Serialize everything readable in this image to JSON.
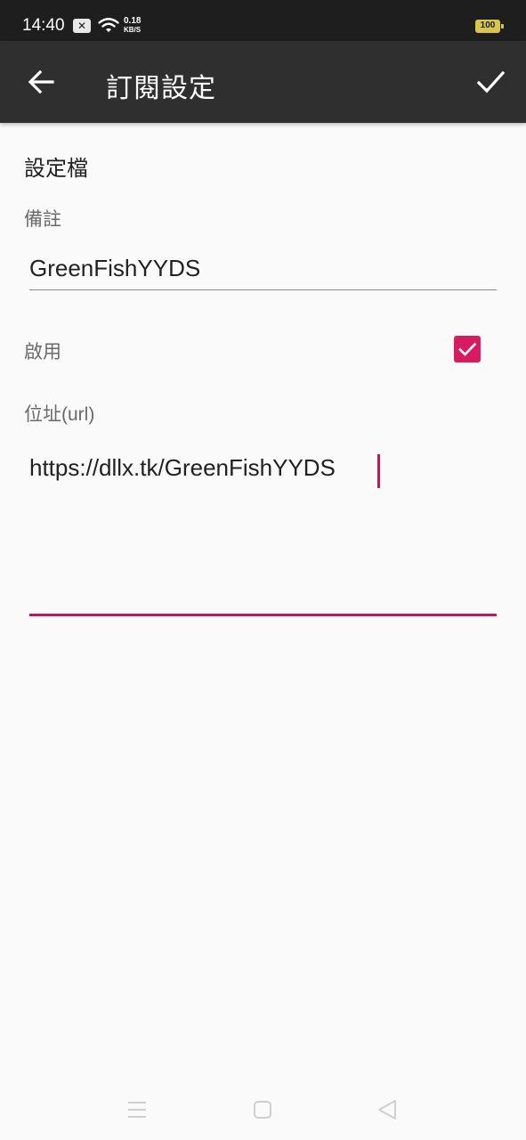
{
  "status_bar": {
    "time": "14:40",
    "notification_icon": "x-notification-icon",
    "net_speed_value": "0.18",
    "net_speed_unit": "KB/S",
    "battery_level": "100",
    "battery_color": "#d8c64a"
  },
  "app_bar": {
    "title": "訂閱設定",
    "back_icon": "arrow-left-icon",
    "save_icon": "check-icon"
  },
  "form": {
    "section_title": "設定檔",
    "remark_label": "備註",
    "remark_value": "GreenFishYYDS",
    "enable_label": "啟用",
    "enabled": true,
    "url_label": "位址(url)",
    "url_value": "https://dllx.tk/GreenFishYYDS"
  },
  "colors": {
    "accent": "#d81b60",
    "app_bar": "#2f2f2f",
    "status_bar": "#1e1e1e",
    "background": "#fafafa"
  },
  "nav_bar": {
    "menu_icon": "menu-icon",
    "home_icon": "home-square-icon",
    "back_icon": "back-triangle-icon"
  }
}
